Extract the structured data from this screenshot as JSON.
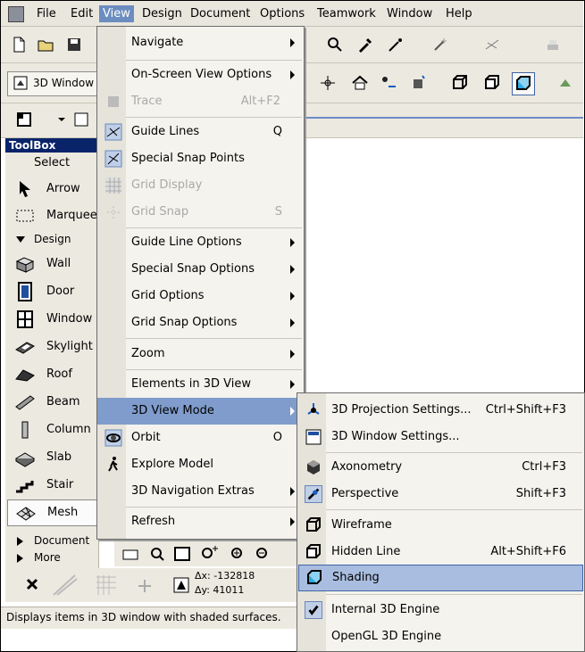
{
  "menubar": {
    "items": [
      "File",
      "Edit",
      "View",
      "Design",
      "Document",
      "Options",
      "Teamwork",
      "Window",
      "Help"
    ],
    "active": "View"
  },
  "toolbar": {
    "window_button_label": "3D Window"
  },
  "toolbox": {
    "title": "ToolBox",
    "select_label": "Select",
    "items_top": [
      "Arrow",
      "Marquee"
    ],
    "section_design": "Design",
    "design_items": [
      "Wall",
      "Door",
      "Window",
      "Skylight",
      "Roof",
      "Beam",
      "Column",
      "Slab",
      "Stair",
      "Mesh"
    ],
    "selected": "Mesh",
    "section_document": "Document",
    "section_more": "More"
  },
  "view_menu": {
    "items": [
      {
        "label": "Navigate",
        "submenu": true
      },
      {
        "label": "On-Screen View Options",
        "submenu": true
      },
      {
        "label": "Trace",
        "shortcut": "Alt+F2",
        "disabled": true
      },
      {
        "label": "Guide Lines",
        "shortcut": "Q"
      },
      {
        "label": "Special Snap Points"
      },
      {
        "label": "Grid Display",
        "disabled": true
      },
      {
        "label": "Grid Snap",
        "shortcut": "S",
        "disabled": true
      },
      {
        "label": "Guide Line Options",
        "submenu": true
      },
      {
        "label": "Special Snap Options",
        "submenu": true
      },
      {
        "label": "Grid Options",
        "submenu": true
      },
      {
        "label": "Grid Snap Options",
        "submenu": true
      },
      {
        "label": "Zoom",
        "submenu": true
      },
      {
        "label": "Elements in 3D View",
        "submenu": true
      },
      {
        "label": "3D View Mode",
        "submenu": true,
        "highlighted": true
      },
      {
        "label": "Orbit",
        "shortcut": "O"
      },
      {
        "label": "Explore Model"
      },
      {
        "label": "3D Navigation Extras",
        "submenu": true
      },
      {
        "label": "Refresh",
        "submenu": true
      }
    ]
  },
  "submenu_3d": {
    "items": [
      {
        "label": "3D Projection Settings...",
        "shortcut": "Ctrl+Shift+F3"
      },
      {
        "label": "3D Window Settings..."
      },
      {
        "label": "Axonometry",
        "shortcut": "Ctrl+F3"
      },
      {
        "label": "Perspective",
        "shortcut": "Shift+F3"
      },
      {
        "label": "Wireframe"
      },
      {
        "label": "Hidden Line",
        "shortcut": "Alt+Shift+F6"
      },
      {
        "label": "Shading",
        "highlighted": true
      },
      {
        "label": "Internal 3D Engine",
        "checked": true
      },
      {
        "label": "OpenGL 3D Engine"
      }
    ]
  },
  "coords": {
    "dx": "Δx: -132818",
    "dy": "Δy: 41011"
  },
  "status_text": "Displays items in 3D window with shaded surfaces.",
  "colors": {
    "menu_highlight": "#7f9ccc",
    "titlebar_blue": "#0a246a",
    "shading_highlight": "#a9bde0"
  }
}
